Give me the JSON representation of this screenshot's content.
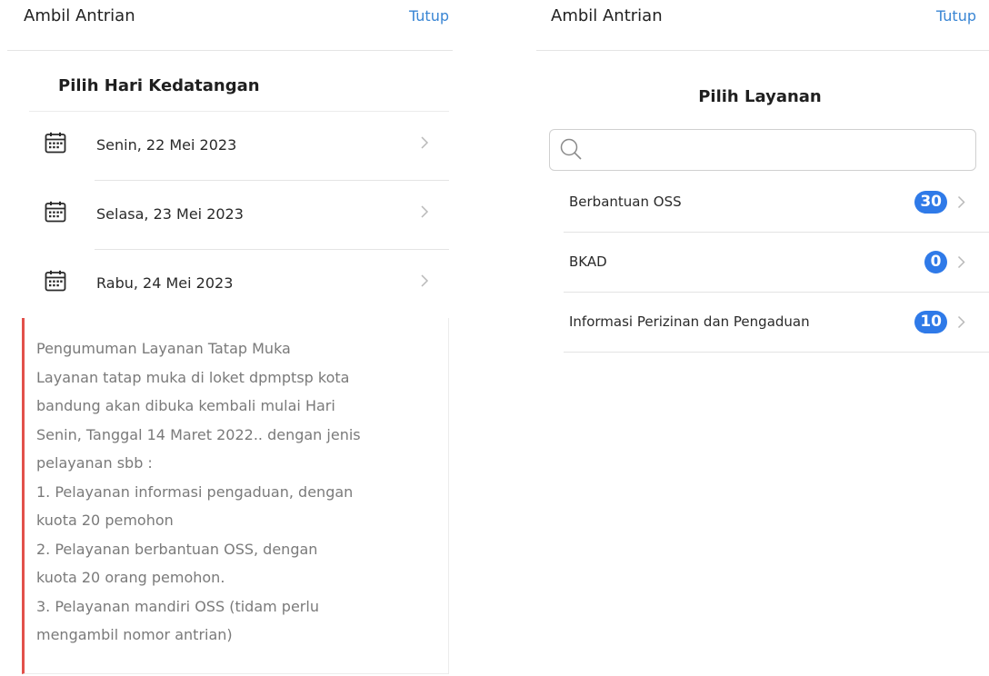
{
  "left_panel": {
    "header": {
      "title": "Ambil Antrian",
      "close_label": "Tutup"
    },
    "section_title": "Pilih Hari Kedatangan",
    "days": [
      {
        "label": "Senin, 22 Mei 2023",
        "icon": "calendar-icon"
      },
      {
        "label": "Selasa, 23 Mei 2023",
        "icon": "calendar-icon"
      },
      {
        "label": "Rabu, 24 Mei 2023",
        "icon": "calendar-icon"
      }
    ],
    "announcement": {
      "lines": [
        "Pengumuman Layanan Tatap Muka",
        "Layanan tatap muka di loket dpmptsp kota",
        "bandung akan dibuka kembali mulai Hari",
        "Senin, Tanggal 14 Maret 2022.. dengan jenis",
        "pelayanan sbb :",
        "1. Pelayanan informasi pengaduan, dengan",
        "kuota 20 pemohon",
        "2. Pelayanan berbantuan OSS, dengan",
        "kuota 20 orang pemohon.",
        "3. Pelayanan mandiri OSS (tidam perlu",
        "mengambil nomor antrian)"
      ],
      "accent_color": "#e2514b"
    }
  },
  "right_panel": {
    "header": {
      "title": "Ambil Antrian",
      "close_label": "Tutup"
    },
    "section_title": "Pilih Layanan",
    "search": {
      "placeholder": "",
      "value": ""
    },
    "services": [
      {
        "label": "Berbantuan OSS",
        "count": "30"
      },
      {
        "label": "BKAD",
        "count": "0"
      },
      {
        "label": "Informasi Perizinan dan Pengaduan",
        "count": "10"
      }
    ]
  },
  "colors": {
    "link": "#3a86d4",
    "badge": "#2f7ae8",
    "divider": "#e4e4e4"
  }
}
